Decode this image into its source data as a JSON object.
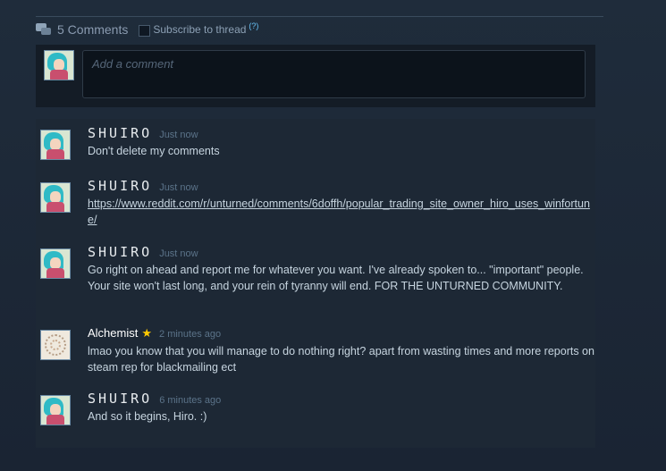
{
  "header": {
    "comment_count": "5 Comments",
    "subscribe_label": "Subscribe to thread",
    "help_label": "(?)"
  },
  "composer": {
    "placeholder": "Add a comment"
  },
  "comments": [
    {
      "author": "SHUIRO",
      "time": "Just now",
      "text": "Don't delete my comments",
      "link": ""
    },
    {
      "author": "SHUIRO",
      "time": "Just now",
      "text": "",
      "link": "https://www.reddit.com/r/unturned/comments/6doffh/popular_trading_site_owner_hiro_uses_winfortune/"
    },
    {
      "author": "SHUIRO",
      "time": "Just now",
      "text": "Go right on ahead and report me for whatever you want. I've already spoken to... \"important\" people. Your site won't last long, and your rein of tyranny will end. FOR THE UNTURNED COMMUNITY.",
      "link": ""
    },
    {
      "author": "Alchemist",
      "badge": "★",
      "time": "2 minutes ago",
      "text": "lmao you know that you will manage to do nothing right? apart from wasting times and more reports on steam rep for blackmailing ect",
      "link": ""
    },
    {
      "author": "SHUIRO",
      "time": "6 minutes ago",
      "text": "And so it begins, Hiro. :)",
      "link": ""
    }
  ],
  "colors": {
    "background": "#1f2c3b",
    "panel": "#1d2835",
    "text": "#c6d4df",
    "timestamp": "#5b7389",
    "star": "#ffc902"
  }
}
